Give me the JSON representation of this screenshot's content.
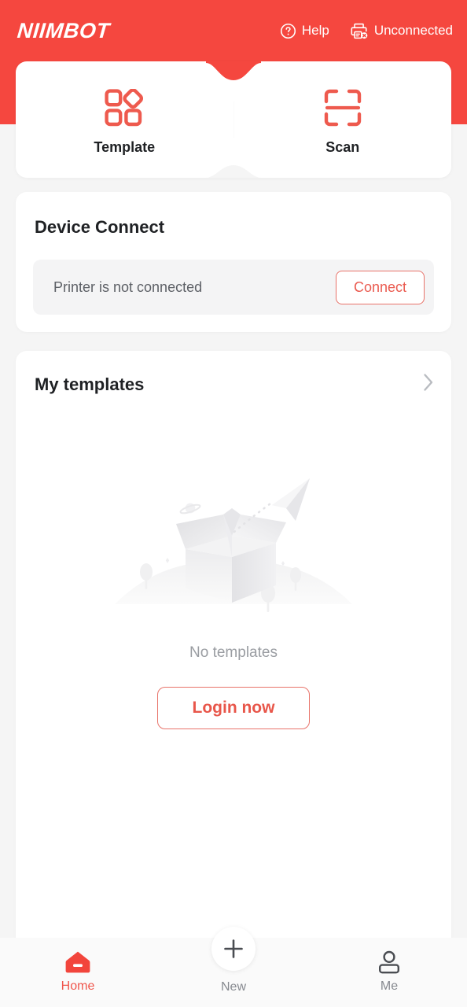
{
  "header": {
    "brand": "NIIMBOT",
    "help_label": "Help",
    "help_icon": "question-circle-icon",
    "connection_label": "Unconnected",
    "connection_icon": "printer-disconnected-icon",
    "background_color": "#f5473f"
  },
  "tabs": [
    {
      "label": "Template",
      "icon": "template-grid-icon"
    },
    {
      "label": "Scan",
      "icon": "scan-frame-icon"
    }
  ],
  "device_connect": {
    "title": "Device Connect",
    "status_text": "Printer is not connected",
    "connect_label": "Connect",
    "accent_color": "#ea5a4f"
  },
  "my_templates": {
    "title": "My templates",
    "chevron_icon": "chevron-right-icon",
    "empty_illustration": "empty-box-paperplane-illustration",
    "empty_text": "No templates",
    "login_label": "Login now"
  },
  "bottom_nav": {
    "items": [
      {
        "label": "Home",
        "icon": "home-icon",
        "active": true
      },
      {
        "label": "New",
        "icon": "plus-icon",
        "active": false
      },
      {
        "label": "Me",
        "icon": "person-icon",
        "active": false
      }
    ],
    "active_color": "#f0564c",
    "inactive_color": "#86898f"
  }
}
